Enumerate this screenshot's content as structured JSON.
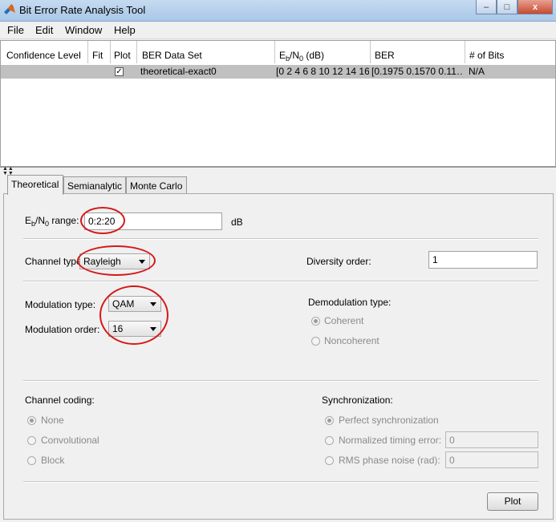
{
  "window": {
    "title": "Bit Error Rate Analysis Tool",
    "minimize": "–",
    "maximize": "□",
    "close": "x"
  },
  "menu": [
    "File",
    "Edit",
    "Window",
    "Help"
  ],
  "table": {
    "headers": {
      "confidence": "Confidence Level",
      "fit": "Fit",
      "plot": "Plot",
      "dataset": "BER Data Set",
      "ebno_pre": "E",
      "ebno_sub1": "b",
      "ebno_mid": "/N",
      "ebno_sub2": "0",
      "ebno_post": " (dB)",
      "ber": "BER",
      "bits": "# of Bits"
    },
    "rows": [
      {
        "confidence": "",
        "fit": "",
        "plot_checked": true,
        "dataset": "theoretical-exact0",
        "ebno": "[0 2 4 6 8 10 12 14 16…",
        "ber": "[0.1975  0.1570  0.11…",
        "bits": "N/A"
      }
    ]
  },
  "tabs": [
    "Theoretical",
    "Semianalytic",
    "Monte Carlo"
  ],
  "theoretical": {
    "ebno_label_pre": "E",
    "ebno_label_sub1": "b",
    "ebno_label_mid": "/N",
    "ebno_label_sub2": "0",
    "ebno_label_post": " range:",
    "ebno_value": "0:2:20",
    "ebno_unit": "dB",
    "channel_type_label": "Channel type:",
    "channel_type_value": "Rayleigh",
    "diversity_label": "Diversity order:",
    "diversity_value": "1",
    "modulation_type_label": "Modulation type:",
    "modulation_type_value": "QAM",
    "modulation_order_label": "Modulation order:",
    "modulation_order_value": "16",
    "demod_label": "Demodulation type:",
    "demod_options": [
      "Coherent",
      "Noncoherent"
    ],
    "coding_label": "Channel coding:",
    "coding_options": [
      "None",
      "Convolutional",
      "Block"
    ],
    "sync_label": "Synchronization:",
    "sync_options": [
      "Perfect synchronization",
      "Normalized timing error:",
      "RMS phase noise (rad):"
    ],
    "timing_error_value": "0",
    "phase_noise_value": "0",
    "plot_button": "Plot"
  },
  "colors": {
    "annotation": "#d61818",
    "title_bar": "#b8d1ec"
  }
}
